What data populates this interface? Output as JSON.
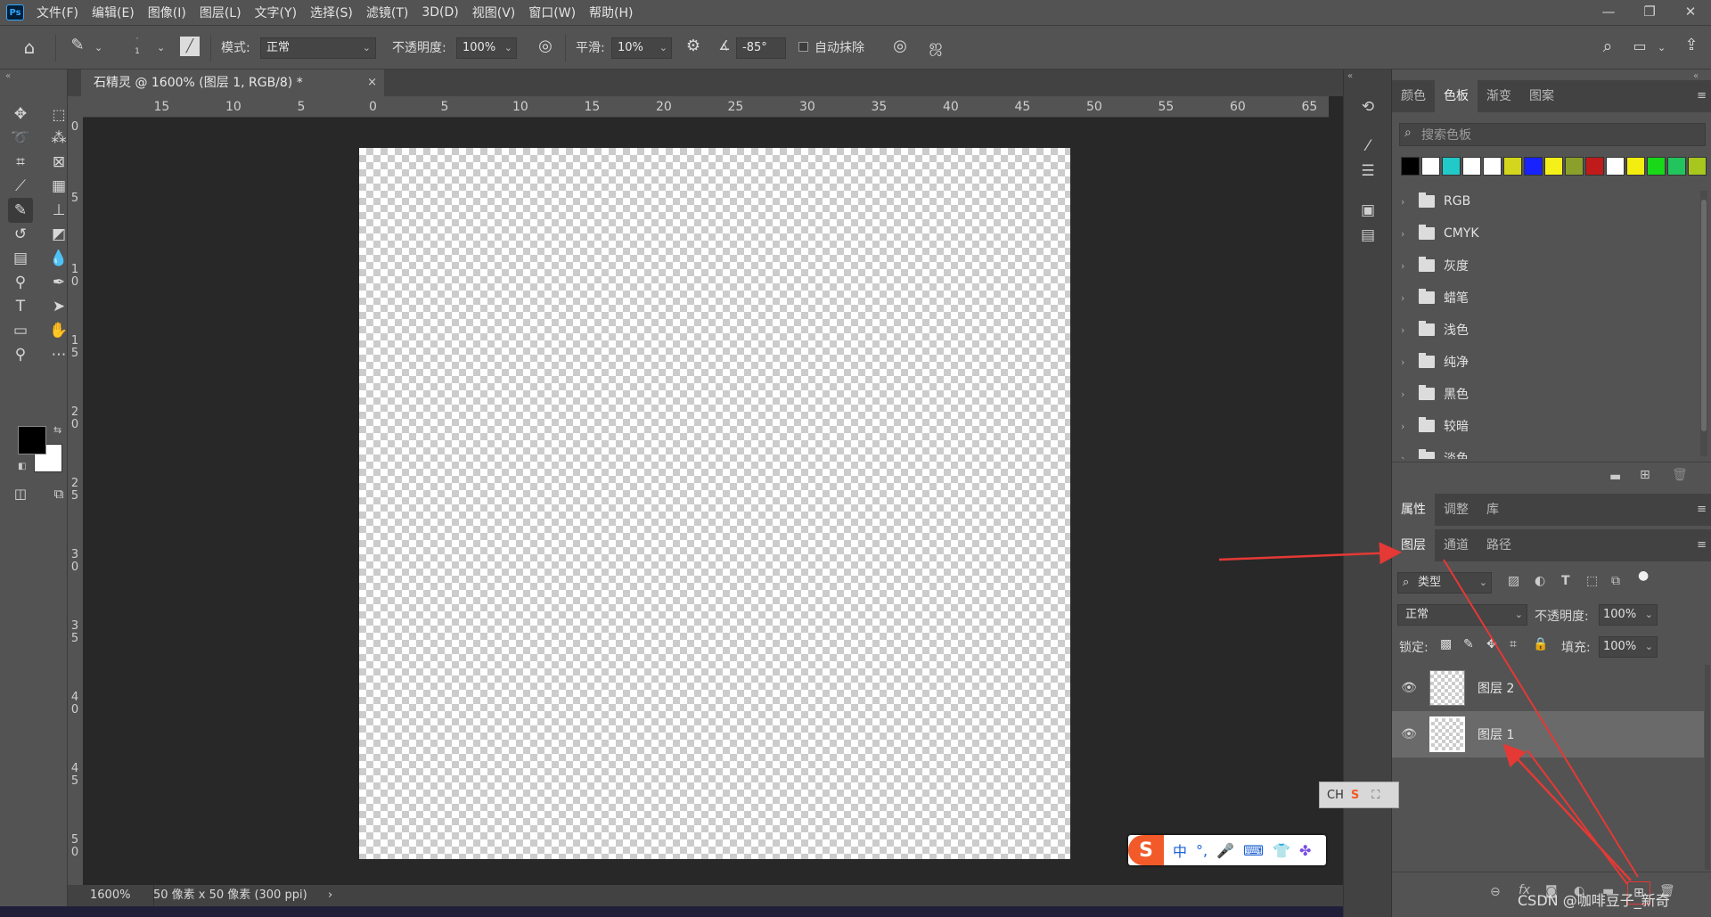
{
  "app": {
    "logo": "Ps"
  },
  "menu": [
    "文件(F)",
    "编辑(E)",
    "图像(I)",
    "图层(L)",
    "文字(Y)",
    "选择(S)",
    "滤镜(T)",
    "3D(D)",
    "视图(V)",
    "窗口(W)",
    "帮助(H)"
  ],
  "window_controls": {
    "minimize": "—",
    "restore": "❐",
    "close": "✕"
  },
  "options": {
    "brush_size": "1",
    "mode_label": "模式:",
    "mode_value": "正常",
    "opacity_label": "不透明度:",
    "opacity_value": "100%",
    "smooth_label": "平滑:",
    "smooth_value": "10%",
    "angle_value": "-85°",
    "auto_erase_label": "自动抹除"
  },
  "document": {
    "tab_title": "石精灵 @ 1600% (图层 1, RGB/8) *",
    "close": "×"
  },
  "ruler": {
    "h_labels": [
      "15",
      "10",
      "5",
      "0",
      "5",
      "10",
      "15",
      "20",
      "25",
      "30",
      "35",
      "40",
      "45",
      "50",
      "55",
      "60",
      "65"
    ],
    "v_labels": [
      "0",
      "5",
      "1\n0",
      "1\n5",
      "2\n0",
      "2\n5",
      "3\n0",
      "3\n5",
      "4\n0",
      "4\n5",
      "5\n0"
    ]
  },
  "status": {
    "zoom": "1600%",
    "doc_info": "50 像素 x 50 像素 (300 ppi)",
    "arrow": "›"
  },
  "swatches_panel": {
    "tabs": [
      "颜色",
      "色板",
      "渐变",
      "图案"
    ],
    "active_tab": "色板",
    "search_placeholder": "搜索色板",
    "colors": [
      "#000000",
      "#ffffff",
      "#21c9c9",
      "#ffffff",
      "#ffffff",
      "#d3d61c",
      "#1722ff",
      "#f5f01a",
      "#8ba02a",
      "#c11a1a",
      "#ffffff",
      "#f4ee10",
      "#18d818",
      "#22c45e",
      "#a7c61e"
    ],
    "groups": [
      "RGB",
      "CMYK",
      "灰度",
      "蜡笔",
      "浅色",
      "纯净",
      "黑色",
      "较暗",
      "淡色"
    ]
  },
  "props_panel": {
    "tabs": [
      "属性",
      "调整",
      "库"
    ],
    "active_tab": "属性"
  },
  "layers_panel": {
    "tabs": [
      "图层",
      "通道",
      "路径"
    ],
    "active_tab": "图层",
    "filter_label": "类型",
    "blend_mode": "正常",
    "opacity_label": "不透明度:",
    "opacity_value": "100%",
    "lock_label": "锁定:",
    "fill_label": "填充:",
    "fill_value": "100%",
    "layers": [
      {
        "name": "图层 2",
        "visible": true,
        "selected": false
      },
      {
        "name": "图层 1",
        "visible": true,
        "selected": true
      }
    ]
  },
  "ime": {
    "mode": "中",
    "punct": "°,",
    "ch_label": "CH"
  },
  "watermark": "CSDN @咖啡豆子_新奇"
}
